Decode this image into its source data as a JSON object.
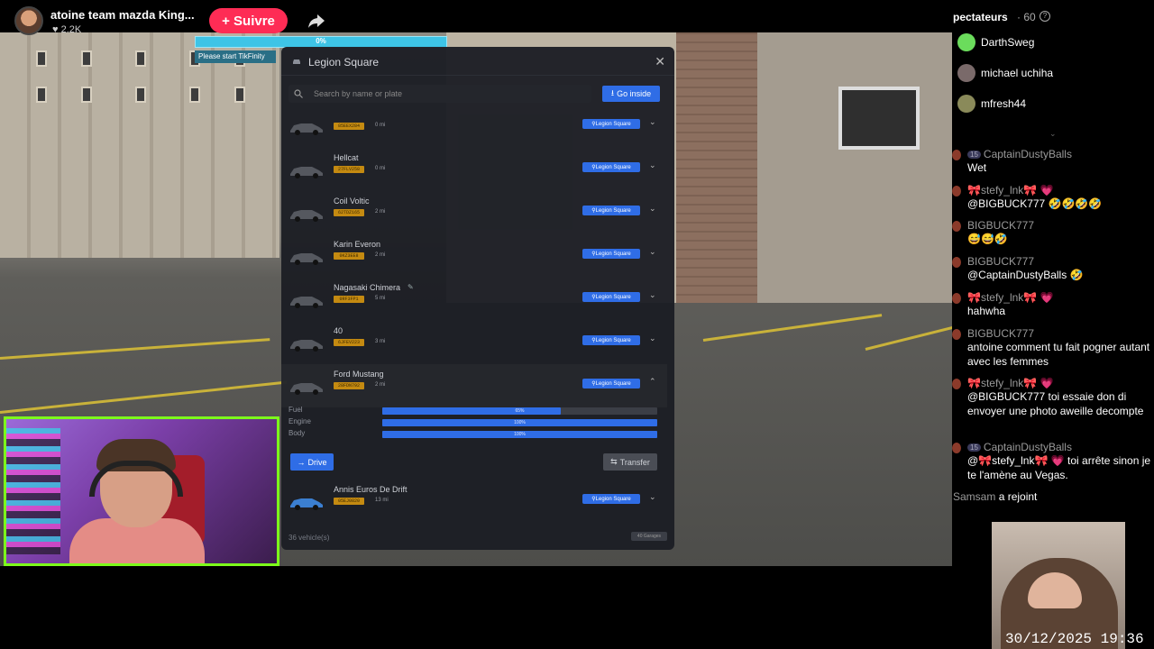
{
  "stream": {
    "title": "atoine team mazda King...",
    "viewers": "♥ 2.2K",
    "follow_label": "+ Suivre"
  },
  "tikfinity": {
    "progress_text": "0%",
    "progress": 0,
    "note": "Please start TikFinity"
  },
  "garage": {
    "title": "Legion Square",
    "search_placeholder": "Search by name or plate",
    "go_inside_label": "Go inside",
    "location_badge": "Legion Square",
    "vehicles": [
      {
        "name": "",
        "plate": "85EEX284",
        "distance": "0 mi",
        "expanded": false
      },
      {
        "name": "Hellcat",
        "plate": "27FLV258",
        "distance": "0 mi",
        "expanded": false
      },
      {
        "name": "Coil Voltic",
        "plate": "62TDZ165",
        "distance": "2 mi",
        "expanded": false
      },
      {
        "name": "Karin Everon",
        "plate": "0KZ3EE8",
        "distance": "2 mi",
        "expanded": false
      },
      {
        "name": "Nagasaki Chimera",
        "plate": "0RF3FP1",
        "distance": "5 mi",
        "expanded": false
      },
      {
        "name": "40",
        "plate": "6JFEV223",
        "distance": "3 mi",
        "expanded": false
      },
      {
        "name": "Ford Mustang",
        "plate": "28FDN792",
        "distance": "2 mi",
        "expanded": true
      }
    ],
    "last_vehicle": {
      "name": "Annis Euros De Drift",
      "plate": "05EJ0820",
      "distance": "13 mi"
    },
    "stats": [
      {
        "label": "Fuel",
        "value": "65%",
        "percent": 65
      },
      {
        "label": "Engine",
        "value": "100%",
        "percent": 100
      },
      {
        "label": "Body",
        "value": "100%",
        "percent": 100
      }
    ],
    "drive_label": "Drive",
    "transfer_label": "Transfer",
    "footer_count": "36 vehicle(s)",
    "footer_badge": "40 Garages"
  },
  "sidebar": {
    "spectators_title": "pectateurs",
    "spectators_count": "· 60",
    "spectators": [
      {
        "name": "DarthSweg",
        "color": "#6bdc5c"
      },
      {
        "name": "michael uchiha",
        "color": "#7a6a6a"
      },
      {
        "name": "mfresh44",
        "color": "#8a8a5a"
      }
    ],
    "messages": [
      {
        "level": "15",
        "user": "CaptainDustyBalls",
        "text": "Wet"
      },
      {
        "level": "",
        "user": "🎀stefy_lnk🎀 💗",
        "text": "@BIGBUCK777 🤣🤣🤣🤣"
      },
      {
        "level": "",
        "user": "BIGBUCK777",
        "text": "😅😅🤣"
      },
      {
        "level": "",
        "user": "BIGBUCK777",
        "text": "@CaptainDustyBalls 🤣"
      },
      {
        "level": "",
        "user": "🎀stefy_lnk🎀 💗",
        "text": "hahwha"
      },
      {
        "level": "",
        "user": "BIGBUCK777",
        "text": "antoine comment tu fait pogner autant avec les femmes"
      },
      {
        "level": "",
        "user": "🎀stefy_lnk🎀 💗",
        "text": "@BIGBUCK777 toi essaie don di envoyer une photo aweille decompte"
      },
      {
        "level": "15",
        "user": "CaptainDustyBalls",
        "text": "@🎀stefy_lnk🎀 💗 toi arrête sinon je te l'amène au Vegas."
      }
    ],
    "joined_user": "Samsam",
    "joined_text": "a rejoint"
  },
  "timestamp": "30/12/2025 19:36"
}
